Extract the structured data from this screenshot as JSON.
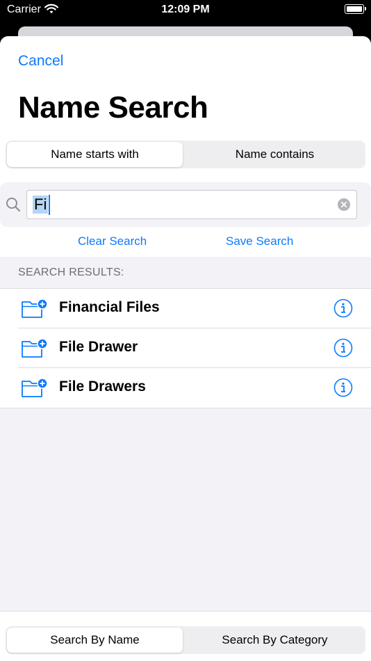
{
  "status_bar": {
    "carrier": "Carrier",
    "time": "12:09 PM"
  },
  "nav": {
    "cancel_label": "Cancel",
    "title": "Name Search"
  },
  "mode_segment": {
    "options": [
      "Name starts with",
      "Name contains"
    ],
    "selected": "Name starts with"
  },
  "search": {
    "value": "Fi"
  },
  "actions": {
    "clear_label": "Clear Search",
    "save_label": "Save Search"
  },
  "results": {
    "header": "SEARCH RESULTS:",
    "items": [
      {
        "label": "Financial Files",
        "icon": "folder-add-icon"
      },
      {
        "label": "File Drawer",
        "icon": "folder-add-icon"
      },
      {
        "label": "File Drawers",
        "icon": "folder-add-icon"
      }
    ]
  },
  "bottom_segment": {
    "options": [
      "Search By Name",
      "Search By Category"
    ],
    "selected": "Search By Name"
  },
  "colors": {
    "accent": "#0a7aff",
    "background": "#f2f2f7"
  }
}
